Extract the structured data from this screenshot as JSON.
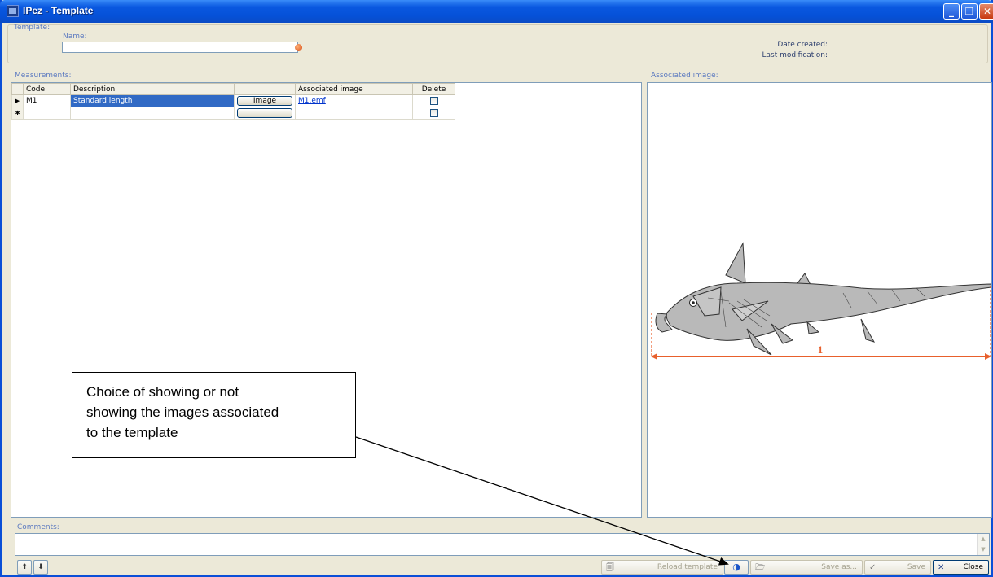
{
  "window": {
    "title": "IPez - Template",
    "min_glyph": "_",
    "max_glyph": "❐",
    "close_glyph": "✕"
  },
  "template_group": {
    "label": "Template:",
    "name_label": "Name:",
    "name_value": "",
    "date_created_label": "Date created:",
    "last_modification_label": "Last modification:"
  },
  "measurements": {
    "label": "Measurements:",
    "columns": [
      "Code",
      "Description",
      "",
      "Associated image",
      "Delete"
    ],
    "rows": [
      {
        "marker": "▶",
        "code": "M1",
        "description": "Standard length",
        "button": "Image",
        "image": "M1.emf",
        "delete": false
      },
      {
        "marker": "✱",
        "code": "",
        "description": "",
        "button": "",
        "image": "",
        "delete": false
      }
    ]
  },
  "associated_image": {
    "label": "Associated image:",
    "measure_number": "1"
  },
  "comments": {
    "label": "Comments:",
    "value": "",
    "scroll_up": "▲",
    "scroll_down": "▼"
  },
  "nav": {
    "up": "⬆",
    "down": "⬇"
  },
  "toolbar": {
    "reload_label": "Reload template",
    "save_as_label": "Save as...",
    "save_label": "Save",
    "close_label": "Close",
    "reload_icon": "🗐",
    "toggle_icon": "◑",
    "open_icon": "🗁",
    "save_icon": "✓",
    "close_icon": "✕"
  },
  "callout": {
    "lines": [
      "Choice of showing or not",
      "showing the images associated",
      "to the template"
    ]
  },
  "colors": {
    "accent": "#0a58e0",
    "selection": "#316ac5",
    "annotation": "#e8602c"
  }
}
